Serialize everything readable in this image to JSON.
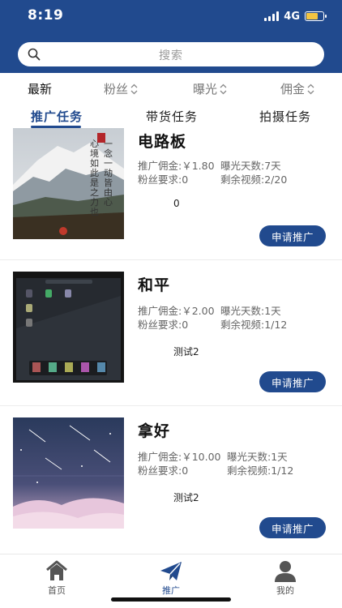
{
  "status_bar": {
    "time": "8:19",
    "network": "4G"
  },
  "search": {
    "placeholder": "搜索"
  },
  "sort_bar": {
    "items": [
      {
        "label": "最新",
        "active": true
      },
      {
        "label": "粉丝",
        "active": false
      },
      {
        "label": "曝光",
        "active": false
      },
      {
        "label": "佣金",
        "active": false
      }
    ]
  },
  "tabs": [
    {
      "label": "推广任务",
      "active": true
    },
    {
      "label": "带货任务",
      "active": false
    },
    {
      "label": "拍摄任务",
      "active": false
    }
  ],
  "tasks": [
    {
      "title": "电路板",
      "commission": "推广佣金:￥1.80",
      "exposure_days": "曝光天数:7天",
      "fans_required": "粉丝要求:0",
      "remaining_videos": "剩余视频:2/20",
      "note": "0",
      "thumb_text_1": "一念一动皆由心",
      "thumb_text_2": "心境如此是之力也",
      "button_label": "申请推广"
    },
    {
      "title": "和平",
      "commission": "推广佣金:￥2.00",
      "exposure_days": "曝光天数:1天",
      "fans_required": "粉丝要求:0",
      "remaining_videos": "剩余视频:1/12",
      "note": "测试2",
      "button_label": "申请推广"
    },
    {
      "title": "拿好",
      "commission": "推广佣金:￥10.00",
      "exposure_days": "曝光天数:1天",
      "fans_required": "粉丝要求:0",
      "remaining_videos": "剩余视频:1/12",
      "note": "测试2",
      "button_label": "申请推广"
    }
  ],
  "bottom_nav": [
    {
      "label": "首页",
      "icon": "home-icon",
      "active": false
    },
    {
      "label": "推广",
      "icon": "paper-plane-icon",
      "active": true
    },
    {
      "label": "我的",
      "icon": "user-icon",
      "active": false
    }
  ],
  "colors": {
    "primary": "#214a8e",
    "battery": "#f4c542"
  }
}
